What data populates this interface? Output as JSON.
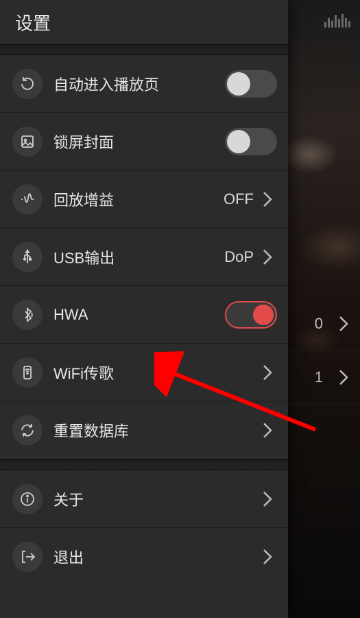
{
  "header": {
    "title": "设置"
  },
  "rows": {
    "autoplay": {
      "label": "自动进入播放页"
    },
    "lockscreen": {
      "label": "锁屏封面"
    },
    "replaygain": {
      "label": "回放增益",
      "value": "OFF"
    },
    "usb": {
      "label": "USB输出",
      "value": "DoP"
    },
    "hwa": {
      "label": "HWA"
    },
    "wifi": {
      "label": "WiFi传歌"
    },
    "rescan": {
      "label": "重置数据库"
    },
    "about": {
      "label": "关于"
    },
    "exit": {
      "label": "退出"
    }
  },
  "bg": {
    "count1": "0",
    "count2": "1"
  }
}
